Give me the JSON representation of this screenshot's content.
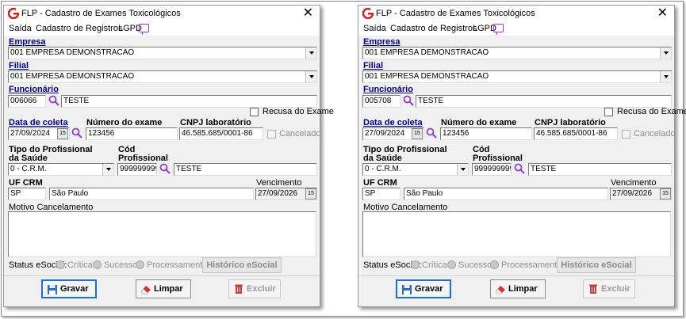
{
  "windows": [
    {
      "title": "FLP - Cadastro de Exames Toxicológicos",
      "menu": [
        "Saída",
        "Cadastro de Registros",
        "LGPD"
      ],
      "empresa_label": "Empresa",
      "empresa_value": "001 EMPRESA DEMONSTRACAO",
      "filial_label": "Filial",
      "filial_value": "001 EMPRESA DEMONSTRACAO",
      "funcionario_label": "Funcionário",
      "funcionario_code": "006066",
      "funcionario_name": "TESTE",
      "recusa_label": "Recusa do Exame",
      "data_coleta_label": "Data de coleta",
      "data_coleta_value": "27/09/2024",
      "numero_exame_label": "Número do exame",
      "numero_exame_value": "123456",
      "cnpj_label": "CNPJ laboratório",
      "cnpj_value": "46.585.685/0001-86",
      "cancelado_label": "Cancelado",
      "tipo_prof_label": "Tipo do Profissional da Saúde",
      "tipo_prof_value": "0 - C.R.M.",
      "cod_prof_label": "Cód Profissional",
      "cod_prof_value": "999999999",
      "prof_name": "TESTE",
      "uf_crm_label": "UF CRM",
      "uf_value": "SP",
      "uf_name": "São Paulo",
      "vencimento_label": "Vencimento",
      "vencimento_value": "27/09/2026",
      "motivo_label": "Motivo Cancelamento",
      "status_label": "Status eSocial:",
      "status_options": [
        "Crítica",
        "Sucesso",
        "Processamento"
      ],
      "historico_label": "Histórico eSocial",
      "gravar_label": "Gravar",
      "limpar_label": "Limpar",
      "excluir_label": "Excluir"
    },
    {
      "title": "FLP - Cadastro de Exames Toxicológicos",
      "menu": [
        "Saída",
        "Cadastro de Registros",
        "LGPD"
      ],
      "empresa_label": "Empresa",
      "empresa_value": "001 EMPRESA DEMONSTRACAO",
      "filial_label": "Filial",
      "filial_value": "001 EMPRESA DEMONSTRACAO",
      "funcionario_label": "Funcionário",
      "funcionario_code": "005708",
      "funcionario_name": "TESTE",
      "recusa_label": "Recusa do Exame",
      "data_coleta_label": "Data de coleta",
      "data_coleta_value": "27/09/2024",
      "numero_exame_label": "Número do exame",
      "numero_exame_value": "123456",
      "cnpj_label": "CNPJ laboratório",
      "cnpj_value": "46.585.685/0001-86",
      "cancelado_label": "Cancelado",
      "tipo_prof_label": "Tipo do Profissional da Saúde",
      "tipo_prof_value": "0 - C.R.M.",
      "cod_prof_label": "Cód Profissional",
      "cod_prof_value": "999999999",
      "prof_name": "TESTE",
      "uf_crm_label": "UF CRM",
      "uf_value": "SP",
      "uf_name": "São Paulo",
      "vencimento_label": "Vencimento",
      "vencimento_value": "27/09/2026",
      "motivo_label": "Motivo Cancelamento",
      "status_label": "Status eSocial:",
      "status_options": [
        "Crítica",
        "Sucesso",
        "Processamento"
      ],
      "historico_label": "Histórico eSocial",
      "gravar_label": "Gravar",
      "limpar_label": "Limpar",
      "excluir_label": "Excluir"
    }
  ],
  "icons": {
    "logo": "flp-logo-icon",
    "search": "magnifier-icon",
    "calendar": "calendar-icon",
    "gravar": "save-icon",
    "limpar": "eraser-icon",
    "excluir": "trash-icon",
    "lgpd": "monitor-chat-icon"
  },
  "colors": {
    "logo_red": "#d22020",
    "search_purple": "#8a3fd1",
    "primary_border": "#1a6fd8",
    "label_blue": "#000080"
  }
}
